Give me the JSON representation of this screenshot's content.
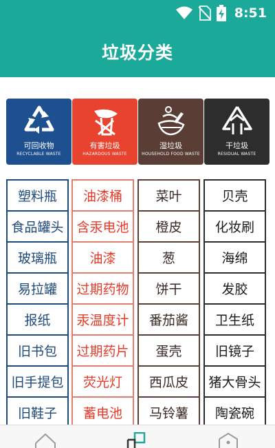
{
  "status": {
    "time": "8:51"
  },
  "app": {
    "title": "垃圾分类"
  },
  "bins": [
    {
      "cn": "可回收物",
      "en": "RECYCLABLE WASTE",
      "color": "#1e5090",
      "icon": "recycle-icon"
    },
    {
      "cn": "有害垃圾",
      "en": "HAZARDOUS WASTE",
      "color": "#e8432e",
      "icon": "hazardous-icon"
    },
    {
      "cn": "湿垃圾",
      "en": "HOUSEHOLD FOOD WASTE",
      "color": "#5a3e36",
      "icon": "food-waste-icon"
    },
    {
      "cn": "干垃圾",
      "en": "RESIDUAL WASTE",
      "color": "#2d2d2d",
      "icon": "residual-icon"
    }
  ],
  "columns": [
    {
      "border": "#1e4a7a",
      "text": "#1e4a7a",
      "items": [
        "塑料瓶",
        "食品罐头",
        "玻璃瓶",
        "易拉罐",
        "报纸",
        "旧书包",
        "旧手提包",
        "旧鞋子"
      ]
    },
    {
      "border": "#e07b6e",
      "text": "#e63a28",
      "items": [
        "油漆桶",
        "含汞电池",
        "油漆",
        "过期药物",
        "汞温度计",
        "过期药片",
        "荧光灯",
        "蓄电池"
      ]
    },
    {
      "border": "#5a3e36",
      "text": "#3a2a24",
      "items": [
        "菜叶",
        "橙皮",
        "葱",
        "饼干",
        "番茄酱",
        "蛋壳",
        "西瓜皮",
        "马铃薯"
      ]
    },
    {
      "border": "#2b2b2b",
      "text": "#1a1a1a",
      "items": [
        "贝壳",
        "化妆刷",
        "海绵",
        "发胶",
        "卫生纸",
        "旧镜子",
        "猪大骨头",
        "陶瓷碗"
      ]
    }
  ],
  "nav": [
    "home-icon",
    "category-icon",
    "profile-icon"
  ]
}
